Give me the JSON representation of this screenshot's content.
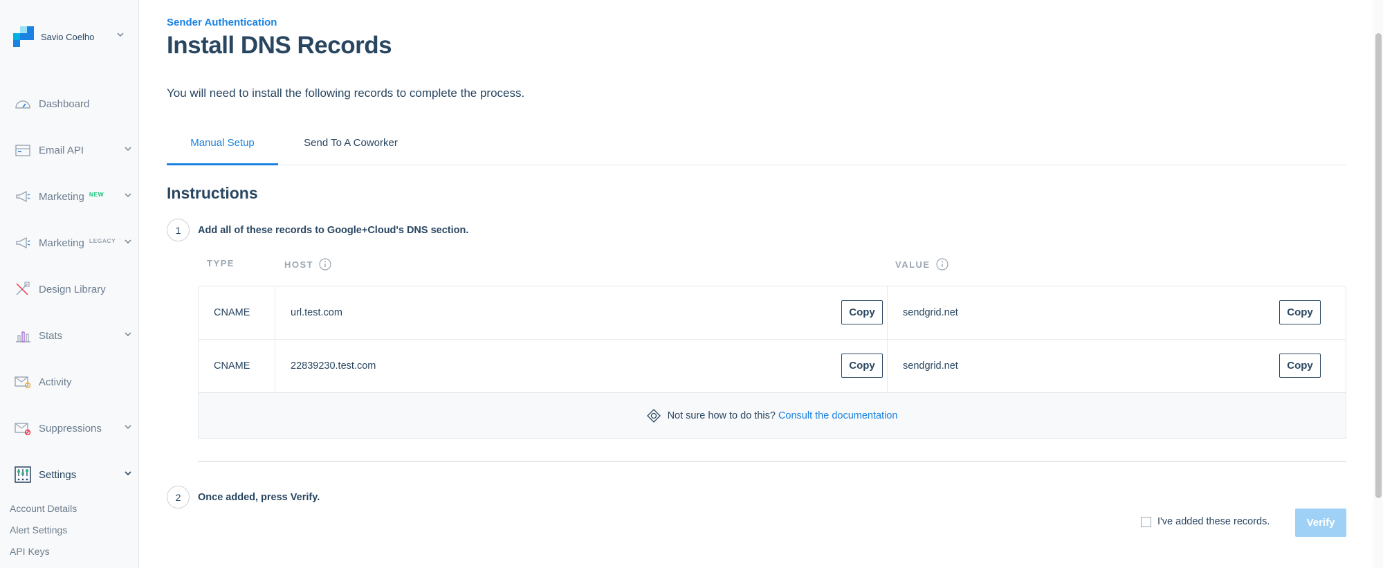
{
  "account": {
    "name": "Savio Coelho"
  },
  "sidebar": {
    "items": [
      {
        "label": "Dashboard",
        "icon": "dashboard-icon",
        "badge": ""
      },
      {
        "label": "Email API",
        "icon": "email-api-icon",
        "badge": ""
      },
      {
        "label": "Marketing",
        "icon": "megaphone-icon",
        "badge": "NEW"
      },
      {
        "label": "Marketing",
        "icon": "megaphone-icon",
        "badge": "LEGACY"
      },
      {
        "label": "Design Library",
        "icon": "design-library-icon",
        "badge": ""
      },
      {
        "label": "Stats",
        "icon": "stats-icon",
        "badge": ""
      },
      {
        "label": "Activity",
        "icon": "activity-icon",
        "badge": ""
      },
      {
        "label": "Suppressions",
        "icon": "suppressions-icon",
        "badge": ""
      },
      {
        "label": "Settings",
        "icon": "settings-icon",
        "badge": ""
      }
    ],
    "settings_sub": [
      "Account Details",
      "Alert Settings",
      "API Keys"
    ]
  },
  "page": {
    "breadcrumb": "Sender Authentication",
    "title": "Install DNS Records",
    "intro": "You will need to install the following records to complete the process."
  },
  "tabs": [
    {
      "label": "Manual Setup",
      "active": true
    },
    {
      "label": "Send To A Coworker",
      "active": false
    }
  ],
  "instructions": {
    "title": "Instructions",
    "step1": {
      "num": "1",
      "text": "Add all of these records to Google+Cloud's DNS section."
    },
    "step2": {
      "num": "2",
      "text": "Once added, press Verify."
    }
  },
  "table": {
    "headers": {
      "type": "TYPE",
      "host": "HOST",
      "value": "VALUE"
    },
    "copy_label": "Copy",
    "rows": [
      {
        "type": "CNAME",
        "host": "url.test.com",
        "value": "sendgrid.net"
      },
      {
        "type": "CNAME",
        "host": "22839230.test.com",
        "value": "sendgrid.net"
      }
    ],
    "help_text": "Not sure how to do this?",
    "help_link": "Consult the documentation"
  },
  "confirm": {
    "checkbox_label": "I've added these records.",
    "verify_label": "Verify"
  },
  "colors": {
    "accent": "#1a82e2",
    "text": "#294661",
    "muted": "#6b7c8f",
    "new_badge": "#1ec37b",
    "verify_disabled": "#9fd1f6"
  }
}
